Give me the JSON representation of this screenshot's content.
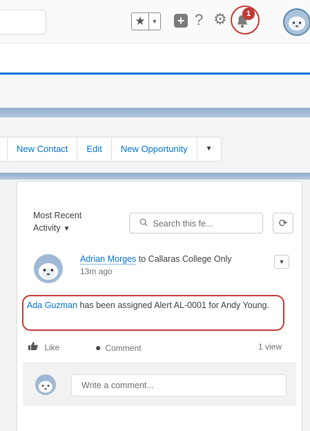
{
  "header": {
    "icons": {
      "favorites": "star-icon",
      "favorites_menu": "chevron-down-icon",
      "global_actions": "plus-icon",
      "help": "question-icon",
      "setup": "gear-icon",
      "notifications": "bell-icon",
      "avatar": "user-avatar"
    },
    "notification_count": "1",
    "highlight_color": "#c23934"
  },
  "actions": {
    "buttons": [
      "New Contact",
      "Edit",
      "New Opportunity"
    ],
    "accent": "#0070d2"
  },
  "feed": {
    "filter_label": "Most Recent Activity",
    "search_placeholder": "Search this fe...",
    "post": {
      "author": "Adrian Morges",
      "connector": " to Callaras College Only",
      "time": "13m ago",
      "body_link": "Ada Guzman",
      "body_text": " has been assigned Alert AL-0001 for Andy Young."
    },
    "like_label": "Like",
    "comment_label": "Comment",
    "views": "1 view",
    "comment_placeholder": "Write a comment..."
  }
}
